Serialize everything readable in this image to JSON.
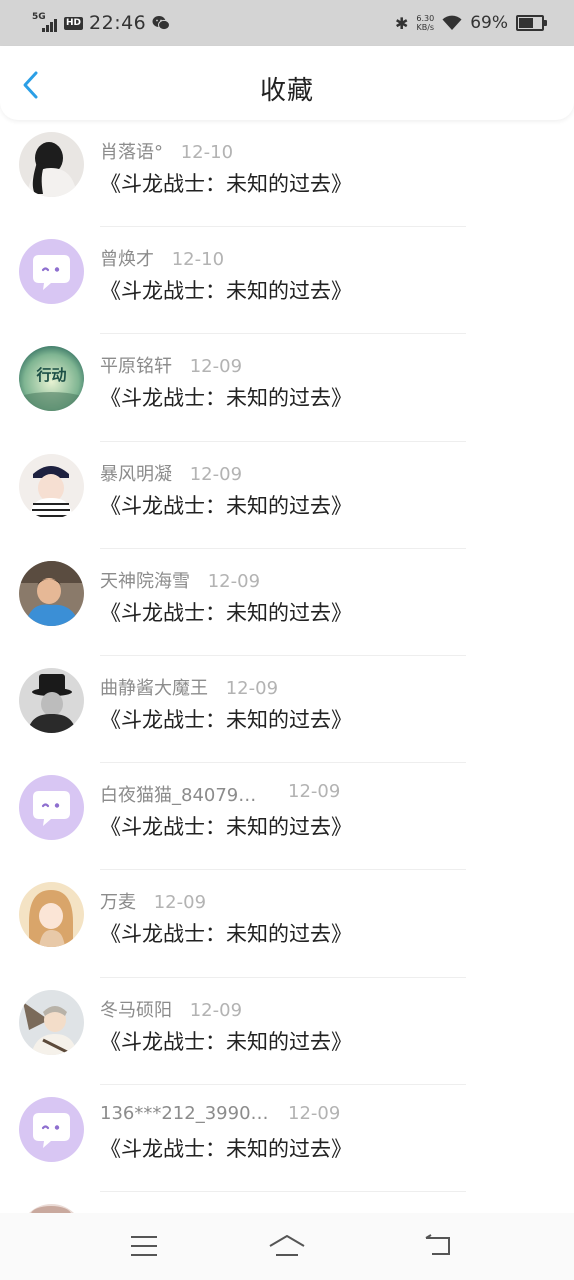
{
  "status_bar": {
    "network": "5G",
    "hd": "HD",
    "time": "22:46",
    "speed_value": "6.30",
    "speed_unit": "KB/s",
    "battery_pct": "69%",
    "battery_level": 0.69
  },
  "header": {
    "title": "收藏",
    "back_icon": "chevron-left-icon",
    "accent": "#2b9fe6"
  },
  "list": {
    "items": [
      {
        "user": "肖落语°",
        "date": "12-10",
        "title": "《斗龙战士：未知的过去》",
        "avatar": "photo"
      },
      {
        "user": "曾焕才",
        "date": "12-10",
        "title": "《斗龙战士：未知的过去》",
        "avatar": "default"
      },
      {
        "user": "平原铭轩",
        "date": "12-09",
        "title": "《斗龙战士：未知的过去》",
        "avatar": "photo",
        "avatar_text": "行动"
      },
      {
        "user": "暴风明凝",
        "date": "12-09",
        "title": "《斗龙战士：未知的过去》",
        "avatar": "photo"
      },
      {
        "user": "天神院海雪",
        "date": "12-09",
        "title": "《斗龙战士：未知的过去》",
        "avatar": "photo"
      },
      {
        "user": "曲静酱大魔王",
        "date": "12-09",
        "title": "《斗龙战士：未知的过去》",
        "avatar": "photo"
      },
      {
        "user": "白夜猫猫_84079…",
        "date": "12-09",
        "title": "《斗龙战士：未知的过去》",
        "avatar": "default"
      },
      {
        "user": "万麦",
        "date": "12-09",
        "title": "《斗龙战士：未知的过去》",
        "avatar": "photo"
      },
      {
        "user": "冬马硕阳",
        "date": "12-09",
        "title": "《斗龙战士：未知的过去》",
        "avatar": "photo"
      },
      {
        "user": "136***212_3990…",
        "date": "12-09",
        "title": "《斗龙战士：未知的过去》",
        "avatar": "default"
      }
    ]
  },
  "colors": {
    "default_avatar_bg": "#d8c6f3",
    "default_avatar_eye": "#8e6fcf"
  },
  "nav_bar": {
    "menu_icon": "menu-icon",
    "home_icon": "home-icon",
    "back_icon": "return-icon"
  }
}
